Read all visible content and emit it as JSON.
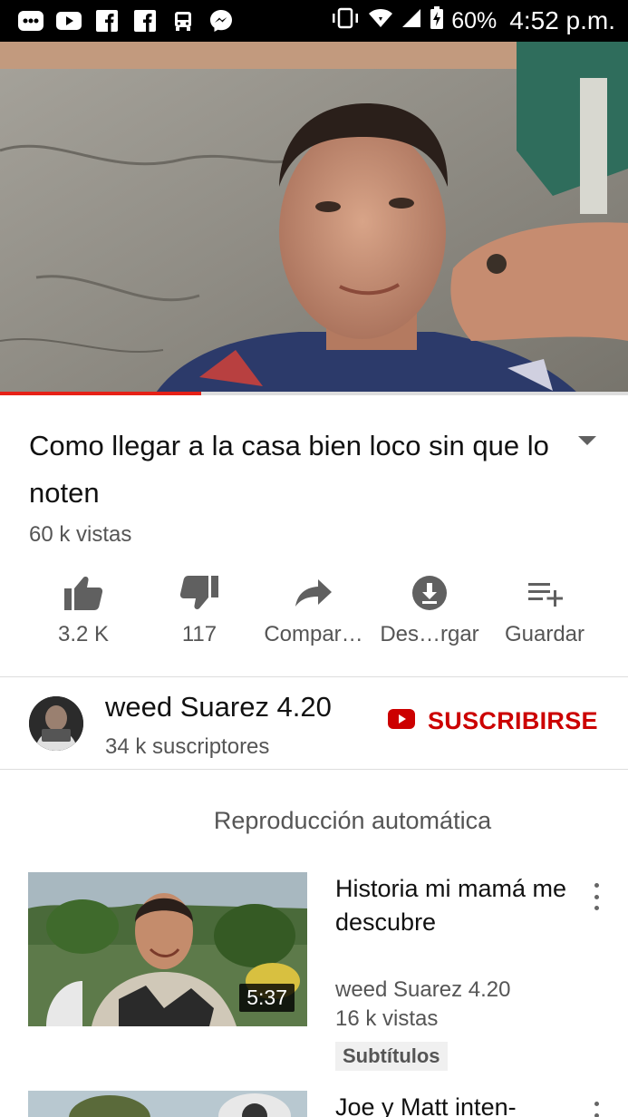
{
  "status_bar": {
    "notification_icons": [
      "more-icon",
      "youtube-icon",
      "facebook-icon",
      "facebook-icon",
      "bus-icon",
      "messenger-icon"
    ],
    "battery": "60%",
    "time": "4:52 p.m."
  },
  "player": {
    "progress_fraction": 0.32
  },
  "video": {
    "title": "Como llegar  a la casa bien loco sin que lo noten",
    "views": "60 k vistas"
  },
  "actions": {
    "like": "3.2 K",
    "dislike": "117",
    "share": "Compar…",
    "download": "Des…rgar",
    "save": "Guardar"
  },
  "channel": {
    "name": "weed Suarez 4.20",
    "subscribers": "34 k suscriptores",
    "subscribe_label": "SUSCRIBIRSE"
  },
  "autoplay": {
    "label": "Reproducción automática"
  },
  "related": [
    {
      "title": "Historia mi mamá me descubre",
      "channel": "weed Suarez 4.20",
      "views": "16 k vistas",
      "badge": "Subtítulos",
      "duration": "5:37"
    },
    {
      "title": "Joe y Matt inten-"
    }
  ],
  "colors": {
    "accent_red": "#cc0000",
    "progress_red": "#e62117"
  }
}
